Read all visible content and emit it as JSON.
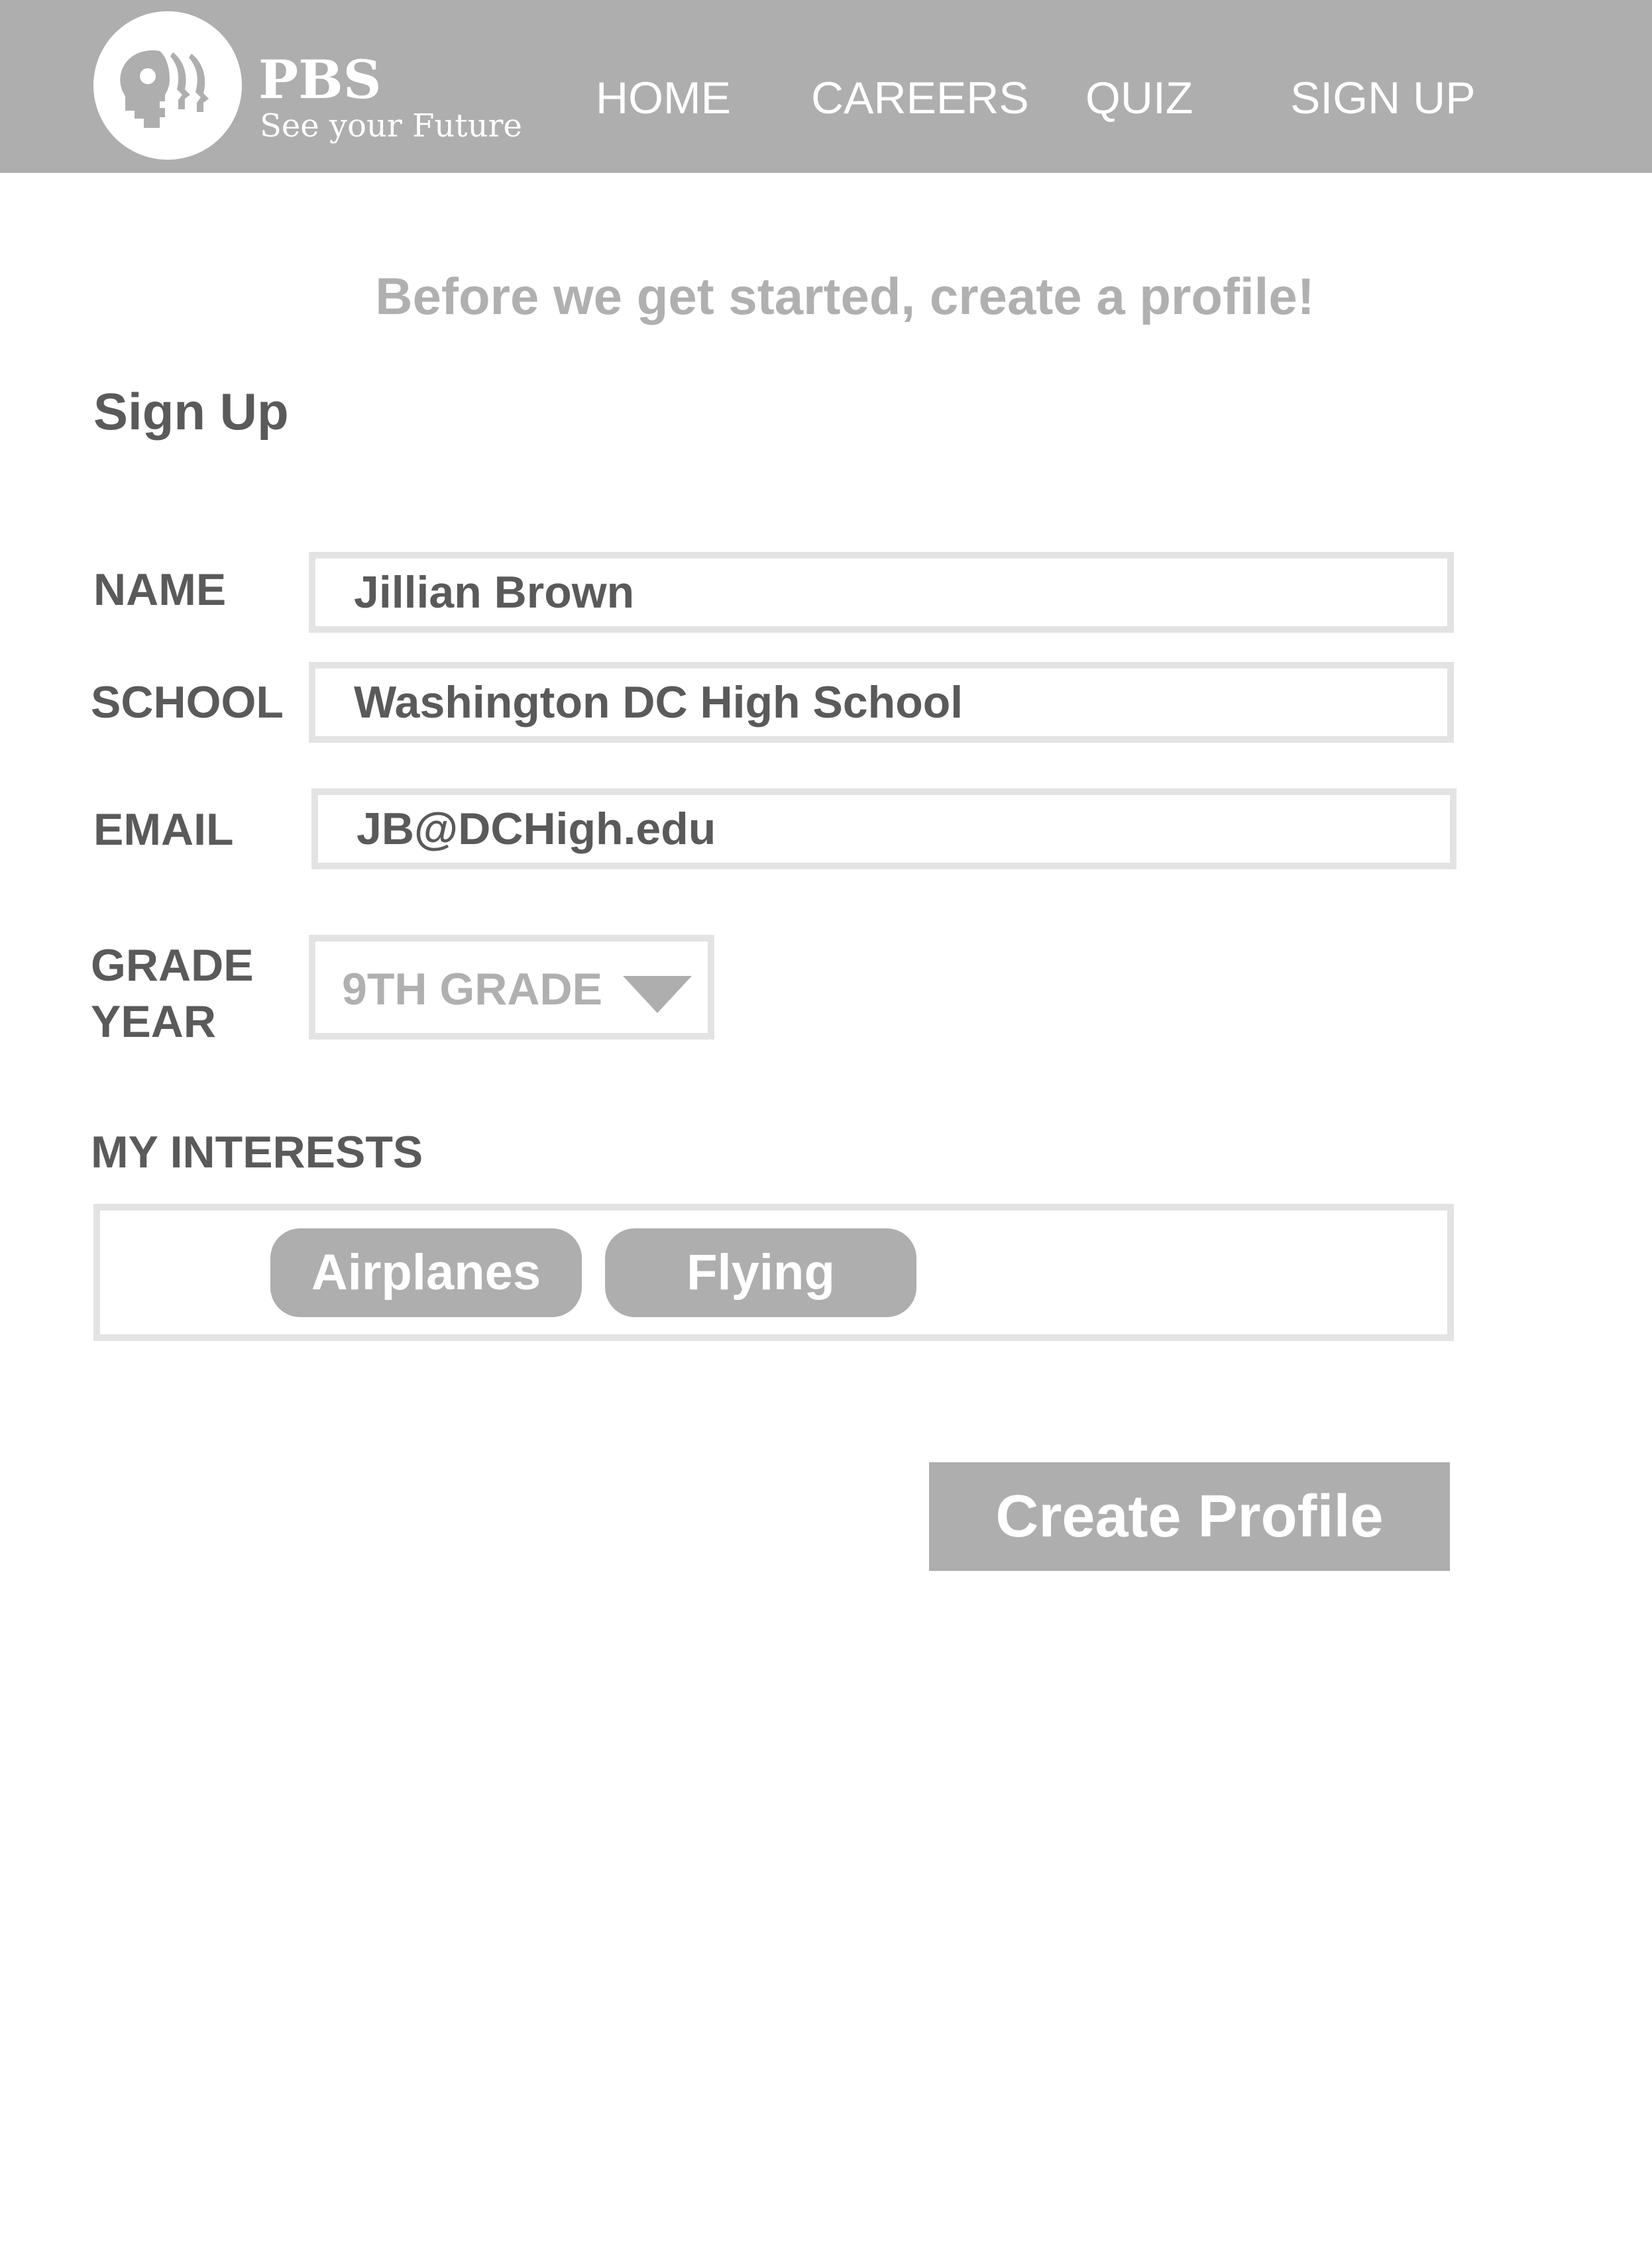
{
  "header": {
    "brand": {
      "name": "PBS",
      "tagline": "See your Future",
      "logo_icon": "pbs-heads-logo"
    },
    "nav": [
      {
        "label": "HOME"
      },
      {
        "label": "CAREERS"
      },
      {
        "label": "QUIZ"
      },
      {
        "label": "SIGN UP"
      }
    ]
  },
  "intro_text": "Before we get started, create a profile!",
  "page_title": "Sign Up",
  "form": {
    "name": {
      "label": "NAME",
      "value": "Jillian Brown"
    },
    "school": {
      "label": "SCHOOL",
      "value": "Washington DC High School"
    },
    "email": {
      "label": "EMAIL",
      "value": "JB@DCHigh.edu"
    },
    "grade_year": {
      "label": "GRADE\nYEAR",
      "selected": "9TH GRADE"
    },
    "interests": {
      "label": "MY INTERESTS",
      "tags": [
        "Airplanes",
        "Flying"
      ]
    },
    "submit_label": "Create Profile"
  },
  "colors": {
    "header_bg": "#aeaeae",
    "text_dark": "#5a5a5a",
    "text_muted": "#b0b0b0",
    "border": "#e3e3e3",
    "button_bg": "#aeaeae"
  }
}
